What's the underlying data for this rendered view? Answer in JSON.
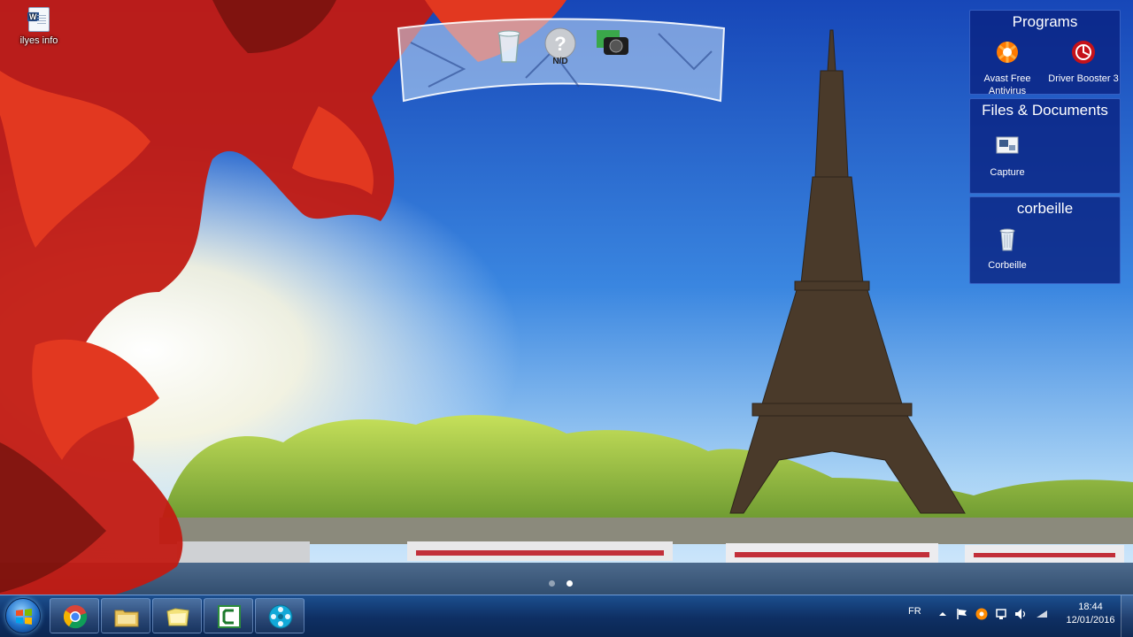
{
  "desktop": {
    "icons": [
      {
        "label": "ilyes info",
        "icon": "word-document-icon"
      }
    ]
  },
  "dock": {
    "items": [
      {
        "icon": "recycle-bin-icon",
        "label": ""
      },
      {
        "icon": "help-icon",
        "label": "N/D"
      },
      {
        "icon": "camera-icon",
        "label": ""
      }
    ]
  },
  "fences": [
    {
      "title": "Programs",
      "items": [
        {
          "label": "Avast Free Antivirus",
          "icon": "avast-icon"
        },
        {
          "label": "Driver Booster 3",
          "icon": "driver-booster-icon"
        }
      ]
    },
    {
      "title": "Files & Documents",
      "items": [
        {
          "label": "Capture",
          "icon": "image-file-icon"
        }
      ]
    },
    {
      "title": "corbeille",
      "items": [
        {
          "label": "Corbeille",
          "icon": "recycle-bin-icon"
        }
      ]
    }
  ],
  "wallpaper_pager": {
    "pages": 2,
    "active": 2
  },
  "taskbar": {
    "pinned": [
      {
        "name": "Google Chrome",
        "icon": "chrome-icon"
      },
      {
        "name": "Windows Explorer",
        "icon": "folder-icon"
      },
      {
        "name": "Folder",
        "icon": "folder-yellow-icon"
      },
      {
        "name": "Camtasia",
        "icon": "camtasia-icon"
      },
      {
        "name": "Media Player",
        "icon": "film-reel-icon"
      }
    ],
    "tray": {
      "language": "FR",
      "time": "18:44",
      "date": "12/01/2016",
      "icons": [
        "show-hidden-icons-icon",
        "action-center-flag-icon",
        "avast-tray-icon",
        "network-icon",
        "volume-icon"
      ]
    }
  },
  "colors": {
    "fence_bg": "#0a2382",
    "taskbar": "#0e2f63",
    "accent": "#ff6a00"
  }
}
